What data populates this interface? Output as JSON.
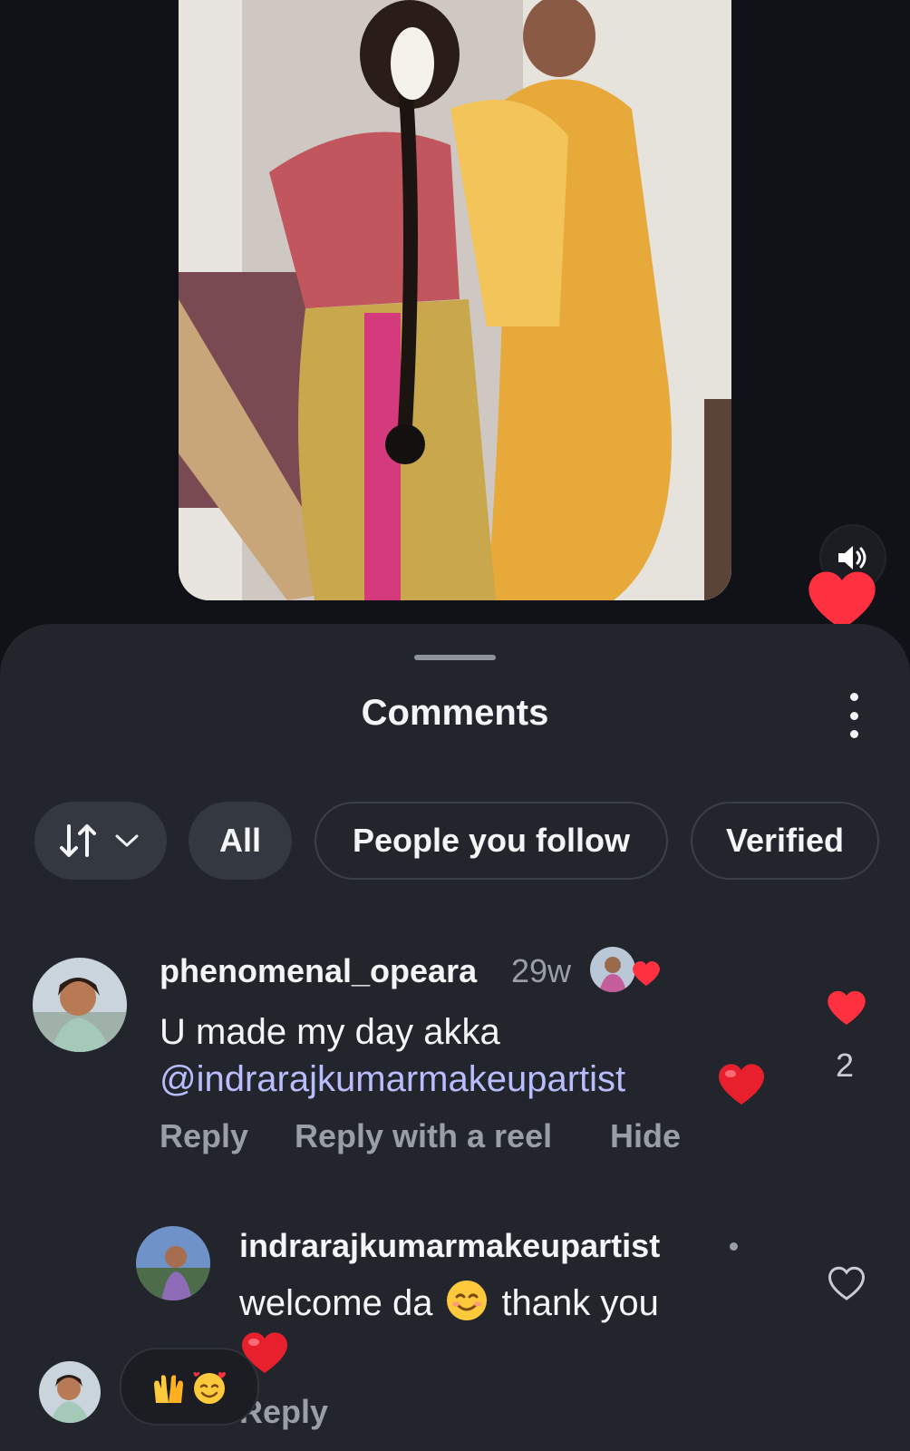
{
  "sheet": {
    "title": "Comments"
  },
  "filters": {
    "sort_icon": "sort-arrows-icon",
    "all": "All",
    "people_you_follow": "People you follow",
    "verified": "Verified"
  },
  "comments": [
    {
      "username": "phenomenal_opeara",
      "time": "29w",
      "text": "U made my day akka",
      "mention": "@indrarajkumarmakeupartist",
      "like_count": "2",
      "actions": {
        "reply": "Reply",
        "reply_reel": "Reply with a reel",
        "hide": "Hide"
      }
    },
    {
      "username": "indrarajkumarmakeupartist",
      "text_before": "welcome da",
      "text_after": "thank you",
      "reply": "Reply"
    }
  ],
  "colors": {
    "background": "#101217",
    "sheet": "#22252b",
    "heart": "#ff3040",
    "mention": "#b7bdfd",
    "muted": "#9a9ea6"
  }
}
